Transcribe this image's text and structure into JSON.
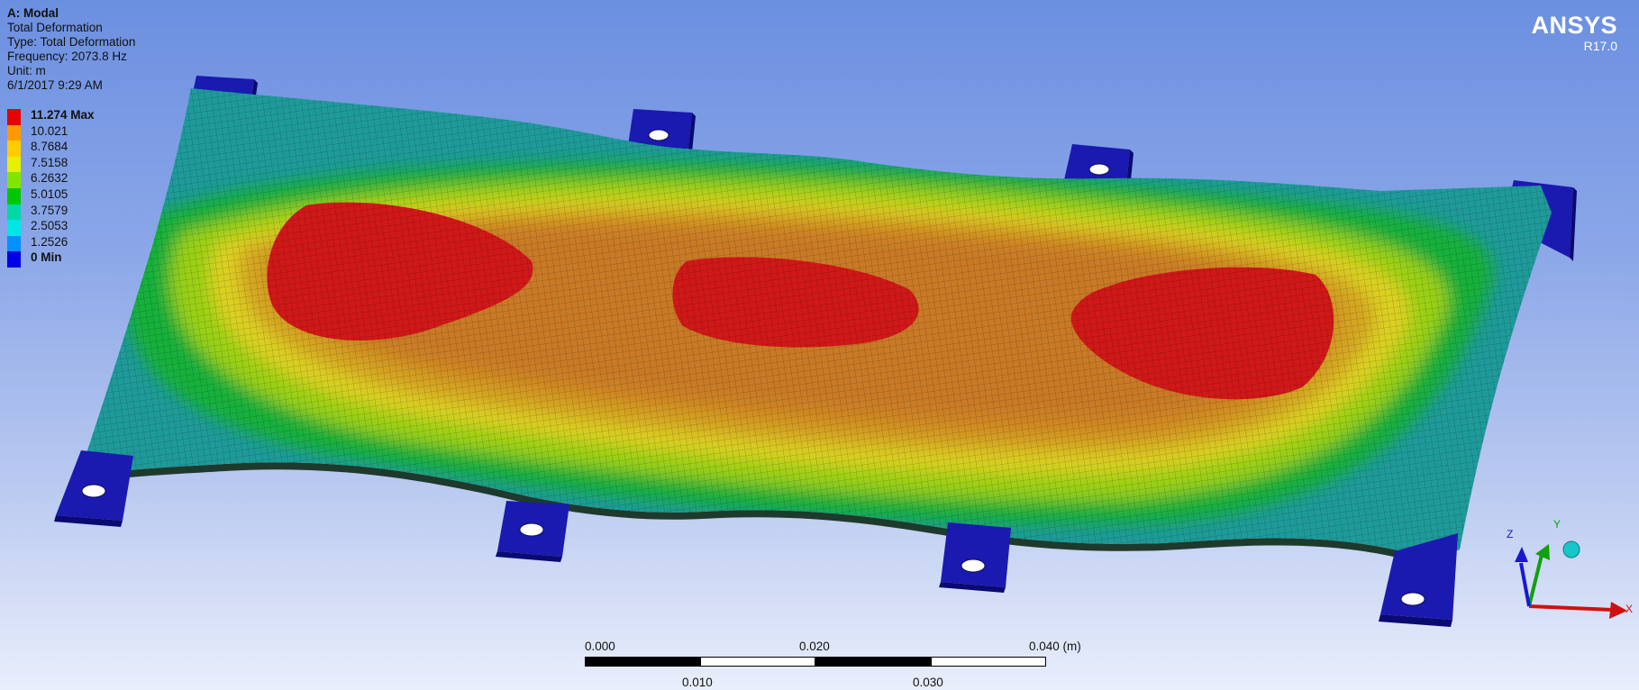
{
  "header": {
    "analysis": "A: Modal",
    "result": "Total Deformation",
    "type_line": "Type: Total Deformation",
    "frequency_line": "Frequency: 2073.8 Hz",
    "unit_line": "Unit: m",
    "timestamp": "6/1/2017 9:29 AM"
  },
  "legend": {
    "items": [
      {
        "label": "11.274 Max",
        "color": "#e60000",
        "bold": true
      },
      {
        "label": "10.021",
        "color": "#ff9900",
        "bold": false
      },
      {
        "label": "8.7684",
        "color": "#ffcc00",
        "bold": false
      },
      {
        "label": "7.5158",
        "color": "#e6f000",
        "bold": false
      },
      {
        "label": "6.2632",
        "color": "#80e600",
        "bold": false
      },
      {
        "label": "5.0105",
        "color": "#00c800",
        "bold": false
      },
      {
        "label": "3.7579",
        "color": "#00d8a8",
        "bold": false
      },
      {
        "label": "2.5053",
        "color": "#00e6e6",
        "bold": false
      },
      {
        "label": "1.2526",
        "color": "#0090ff",
        "bold": false
      },
      {
        "label": "0 Min",
        "color": "#0000e6",
        "bold": true
      }
    ]
  },
  "brand": {
    "name": "ANSYS",
    "version": "R17.0"
  },
  "scale_bar": {
    "top_labels": [
      "0.000",
      "0.020",
      "0.040 (m)"
    ],
    "bottom_labels": [
      "0.010",
      "0.030"
    ]
  },
  "triad": {
    "x": "X",
    "y": "Y",
    "z": "Z"
  }
}
